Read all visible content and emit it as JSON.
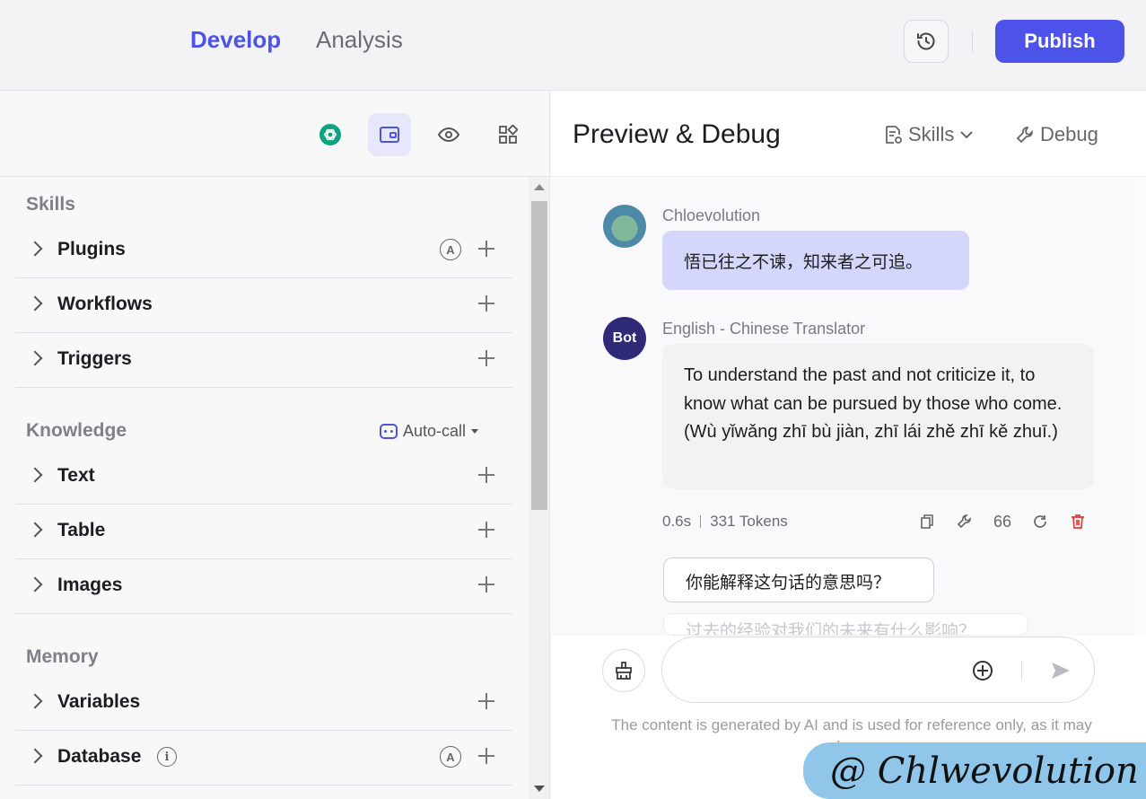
{
  "topbar": {
    "tabs": [
      {
        "label": "Develop",
        "active": true
      },
      {
        "label": "Analysis",
        "active": false
      }
    ],
    "history_icon": "history-icon",
    "publish_label": "Publish",
    "accent_color": "#4d53e8"
  },
  "left_panel": {
    "toolbar_icons": [
      "openai-icon",
      "wallet-icon",
      "eye-icon",
      "grid-icon"
    ],
    "sections": [
      {
        "title": "Skills",
        "items": [
          {
            "label": "Plugins",
            "auto": "A"
          },
          {
            "label": "Workflows"
          },
          {
            "label": "Triggers"
          }
        ]
      },
      {
        "title": "Knowledge",
        "auto_call_label": "Auto-call",
        "items": [
          {
            "label": "Text"
          },
          {
            "label": "Table"
          },
          {
            "label": "Images"
          }
        ]
      },
      {
        "title": "Memory",
        "items": [
          {
            "label": "Variables"
          },
          {
            "label": "Database",
            "info": "i",
            "auto": "A"
          }
        ]
      }
    ]
  },
  "right_panel": {
    "title": "Preview & Debug",
    "skills_label": "Skills",
    "debug_label": "Debug",
    "messages": [
      {
        "sender": "Chloevolution",
        "text": "悟已往之不谏，知来者之可追。"
      },
      {
        "sender": "English - Chinese Translator",
        "avatar_label": "Bot",
        "text": "To understand the past and not criticize it, to know what can be pursued by those who come. (Wù yǐwǎng zhī bù jiàn, zhī lái zhě zhī kě zhuī.)"
      }
    ],
    "meta": {
      "time": "0.6s",
      "tokens": "331 Tokens",
      "quote_label": "66"
    },
    "suggestions": [
      "你能解释这句话的意思吗？",
      "过去的经验对我们的未来有什么影响？"
    ],
    "composer": {
      "placeholder": ""
    },
    "disclaimer": "The content is generated by AI and is used for reference only, as it may be u",
    "watermark": "@ Chlwevolution",
    "delete_color": "#e53935"
  }
}
